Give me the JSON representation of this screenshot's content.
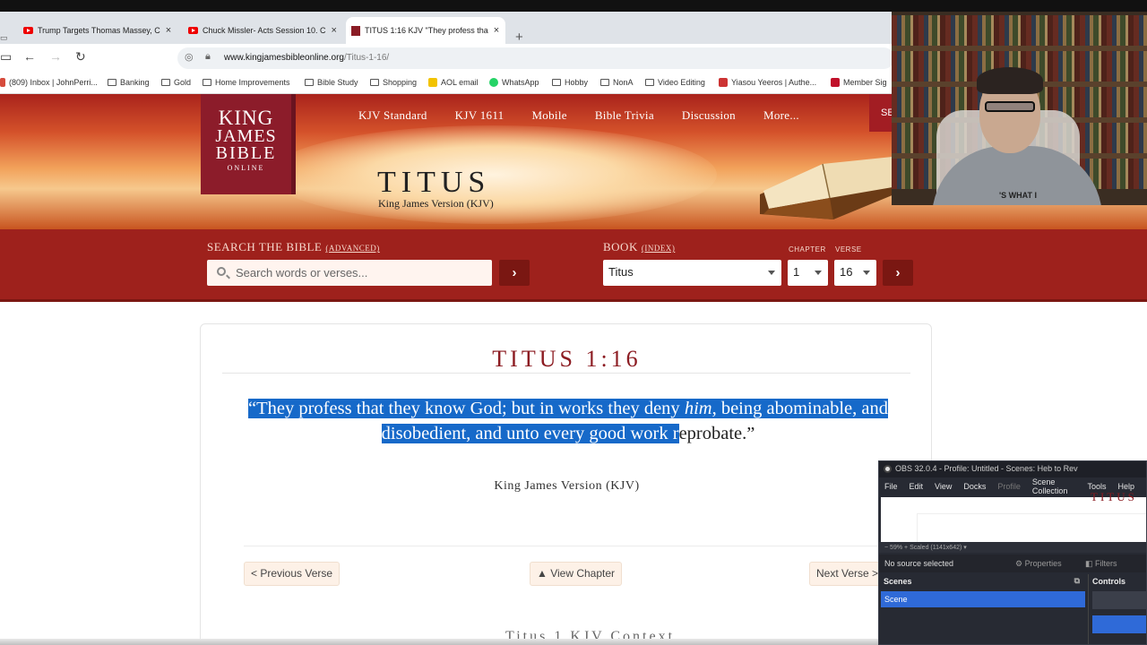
{
  "browser": {
    "tabs": [
      {
        "title": "Trump Targets Thomas Massey, C",
        "icon": "youtube-icon"
      },
      {
        "title": "Chuck Missler- Acts Session 10. C",
        "icon": "youtube-icon"
      },
      {
        "title": "TITUS 1:16 KJV \"They profess tha",
        "icon": "kjv-favicon",
        "active": true
      }
    ],
    "new_tab": "+",
    "close": "×",
    "url_host": "www.kingjamesbibleonline.org",
    "url_path": "/Titus-1-16/",
    "bookmarks": [
      {
        "label": "(809) Inbox | JohnPerri...",
        "icon": "gmail-icon"
      },
      {
        "label": "Banking",
        "icon": "folder-icon"
      },
      {
        "label": "Gold",
        "icon": "folder-icon"
      },
      {
        "label": "Home Improvements",
        "icon": "folder-icon"
      },
      {
        "label": "Bible Study",
        "icon": "folder-icon"
      },
      {
        "label": "Shopping",
        "icon": "folder-icon"
      },
      {
        "label": "AOL email",
        "icon": "aol-icon"
      },
      {
        "label": "WhatsApp",
        "icon": "whatsapp-icon"
      },
      {
        "label": "Hobby",
        "icon": "folder-icon"
      },
      {
        "label": "NonA",
        "icon": "folder-icon"
      },
      {
        "label": "Video Editing",
        "icon": "folder-icon"
      },
      {
        "label": "Yiasou Yeeros | Authe...",
        "icon": "restaurant-icon"
      },
      {
        "label": "Member Sig",
        "icon": "bjs-icon"
      }
    ]
  },
  "site": {
    "logo": {
      "line1": "KING",
      "line2": "JAMES",
      "line3": "BIBLE",
      "line4": "ONLINE"
    },
    "nav": [
      "KJV Standard",
      "KJV 1611",
      "Mobile",
      "Bible Trivia",
      "Discussion",
      "More..."
    ],
    "nav_search_stub": "SE",
    "book_title": "Titus",
    "book_subtitle": "King James Version (KJV)",
    "search": {
      "label": "Search the Bible",
      "advanced": "(advanced)",
      "placeholder": "Search words or verses...",
      "go": "›"
    },
    "book_select": {
      "label": "Book",
      "index": "(index)",
      "value": "Titus",
      "chapter_label": "CHAPTER",
      "chapter_value": "1",
      "verse_label": "VERSE",
      "verse_value": "16",
      "go": "›"
    }
  },
  "content": {
    "reference": "Titus 1:16",
    "verse_highlight_a": "“They profess that they know God; but in works they deny ",
    "verse_italic": "him",
    "verse_highlight_b": ", being abominable, and disobedient, and unto every good work r",
    "verse_rest": "eprobate.”",
    "version": "King James Version (KJV)",
    "prev": "< Previous Verse",
    "view_chapter": "▲ View Chapter",
    "next": "Next Verse >",
    "next_heading": "Titus 1 KJV Context"
  },
  "webcam": {
    "shirt_text": "'S WHAT I"
  },
  "obs": {
    "title": "OBS 32.0.4 - Profile: Untitled - Scenes: Heb to Rev",
    "menu": [
      "File",
      "Edit",
      "View",
      "Docks",
      "Profile",
      "Scene Collection",
      "Tools",
      "Help"
    ],
    "preview_title": "TITUS",
    "zoom": "59%",
    "scaled": "Scaled (1141x642)",
    "no_source": "No source selected",
    "properties": "Properties",
    "filters": "Filters",
    "scenes_header": "Scenes",
    "controls_header": "Controls",
    "scene_item": "Scene"
  },
  "colors": {
    "brand_red": "#8c1c22",
    "band_red": "#9e211c",
    "selection_blue": "#1669c9"
  }
}
